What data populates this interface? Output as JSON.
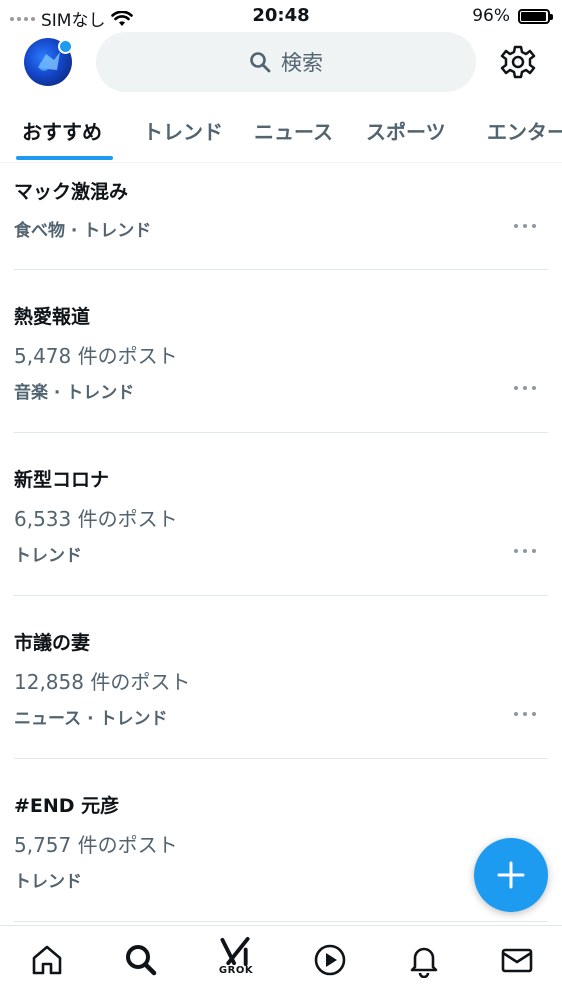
{
  "status_bar": {
    "carrier": "SIMなし",
    "time": "20:48",
    "battery": "96%"
  },
  "header": {
    "search_placeholder": "検索"
  },
  "tabs": [
    {
      "label": "おすすめ",
      "active": true
    },
    {
      "label": "トレンド"
    },
    {
      "label": "ニュース"
    },
    {
      "label": "スポーツ"
    },
    {
      "label": "エンター"
    }
  ],
  "trends": [
    {
      "title": "マック激混み",
      "posts": "",
      "category": "食べ物 · トレンド"
    },
    {
      "title": "熱愛報道",
      "posts": "5,478 件のポスト",
      "category": "音楽 · トレンド"
    },
    {
      "title": "新型コロナ",
      "posts": "6,533 件のポスト",
      "category": "トレンド"
    },
    {
      "title": "市議の妻",
      "posts": "12,858 件のポスト",
      "category": "ニュース · トレンド"
    },
    {
      "title": "#END 元彦",
      "posts": "5,757 件のポスト",
      "category": "トレンド"
    }
  ],
  "bottom_nav": {
    "grok_label": "GROK"
  },
  "colors": {
    "accent": "#1d9bf0",
    "secondary_text": "#536471"
  }
}
